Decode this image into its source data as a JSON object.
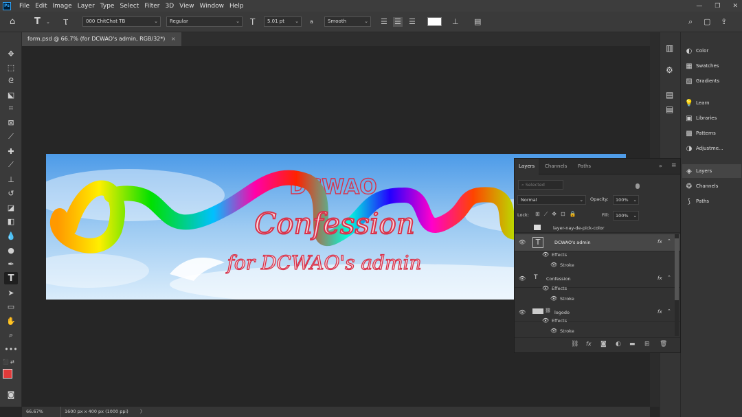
{
  "app": {
    "logo": "Ps"
  },
  "menu": [
    "File",
    "Edit",
    "Image",
    "Layer",
    "Type",
    "Select",
    "Filter",
    "3D",
    "View",
    "Window",
    "Help"
  ],
  "options": {
    "font_family": "000 ChitChat TB",
    "font_style": "Regular",
    "font_size": "5.01 pt",
    "antialias_icon_text": "a",
    "antialias": "Smooth",
    "text_tool_glyph": "T",
    "color_swatch": "#ffffff"
  },
  "document": {
    "tab_title": "form.psd @ 66.7% (for DCWAO's admin, RGB/32*)",
    "close": "×",
    "canvas_texts": {
      "logo": "DCWAO",
      "title": "Confession",
      "subtitle": "for DCWAO's admin"
    }
  },
  "status": {
    "zoom": "66.67%",
    "dimensions": "1600 px x 400 px (1000 ppi)",
    "arrow": "〉"
  },
  "right_panels": {
    "items": [
      {
        "label": "Color",
        "icon": "color-wheel-icon"
      },
      {
        "label": "Swatches",
        "icon": "grid-icon"
      },
      {
        "label": "Gradients",
        "icon": "gradient-icon"
      },
      {
        "label": "Learn",
        "icon": "lightbulb-icon"
      },
      {
        "label": "Libraries",
        "icon": "libraries-icon"
      },
      {
        "label": "Patterns",
        "icon": "patterns-icon"
      },
      {
        "label": "Adjustme...",
        "icon": "adjustments-icon"
      },
      {
        "label": "Layers",
        "icon": "layers-icon"
      },
      {
        "label": "Channels",
        "icon": "channels-icon"
      },
      {
        "label": "Paths",
        "icon": "paths-icon"
      }
    ]
  },
  "layers_panel": {
    "tabs": [
      "Layers",
      "Channels",
      "Paths"
    ],
    "filter_placeholder": "Selected",
    "blend_mode": "Normal",
    "opacity_label": "Opacity:",
    "opacity": "100%",
    "lock_label": "Lock:",
    "fill_label": "Fill:",
    "fill": "100%",
    "layers": [
      {
        "name": "layer-nay-de-pick-color",
        "kind": "group"
      },
      {
        "name": "DCWAO's admin",
        "kind": "text",
        "fx": "fx",
        "effects": "Effects",
        "effect": "Stroke"
      },
      {
        "name": "Confession",
        "kind": "text",
        "fx": "fx",
        "effects": "Effects",
        "effect": "Stroke"
      },
      {
        "name": "logodo",
        "kind": "image",
        "fx": "fx",
        "effects": "Effects",
        "effect": "Stroke"
      }
    ]
  },
  "colors": {
    "foreground": "#e03a3a",
    "background": "#ffffff",
    "accent": "#31a8ff"
  }
}
